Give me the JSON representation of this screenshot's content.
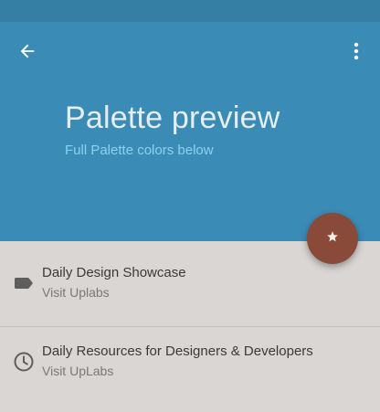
{
  "header": {
    "title": "Palette preview",
    "subtitle": "Full Palette colors below",
    "back_icon": "arrow-back-icon",
    "more_icon": "more-vert-icon"
  },
  "fab": {
    "icon": "star-icon"
  },
  "list": {
    "items": [
      {
        "icon": "label-tag-icon",
        "title": "Daily Design Showcase",
        "subtitle": "Visit Uplabs"
      },
      {
        "icon": "clock-icon",
        "title": "Daily Resources for Designers & Developers",
        "subtitle": "Visit UpLabs"
      }
    ]
  },
  "colors": {
    "status_bar": "#367fa4",
    "header_bg": "#3b8bb7",
    "accent": "#8a4a39",
    "subtitle_text": "#8cd0f2",
    "list_bg": "#d9d6d3"
  }
}
